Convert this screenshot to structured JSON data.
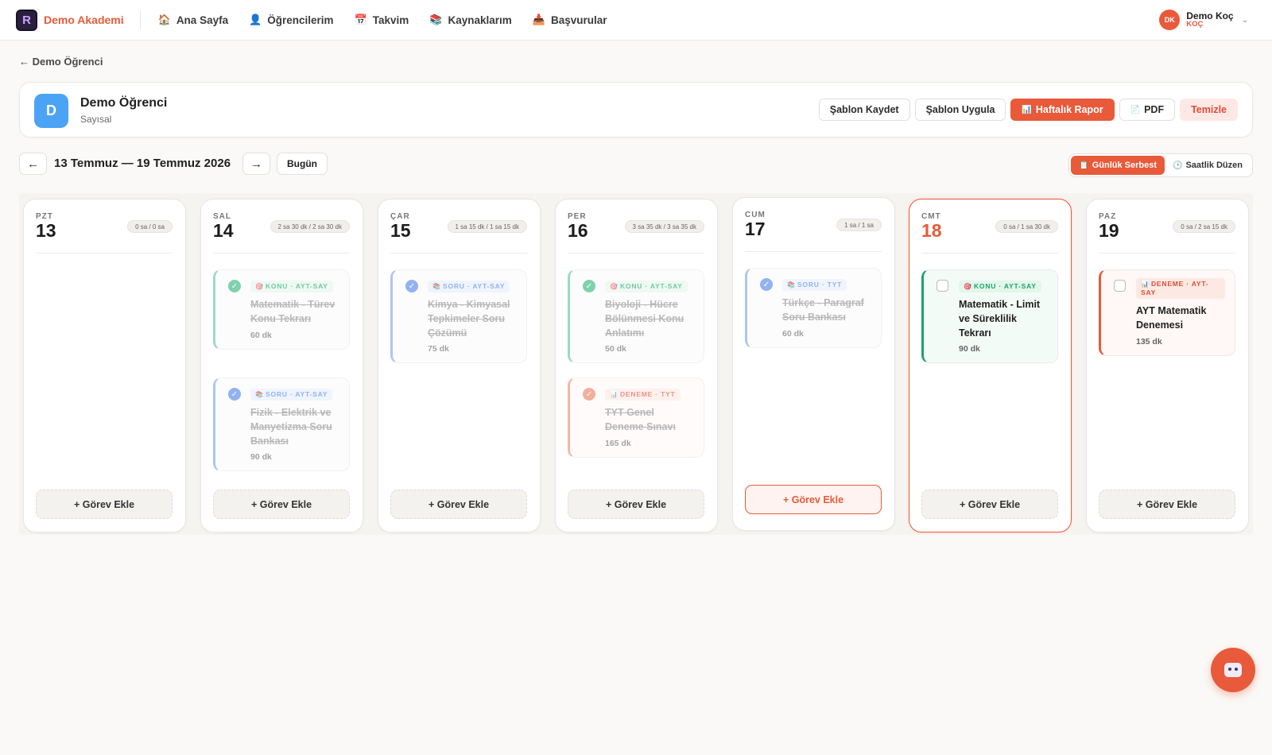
{
  "nav": {
    "brand": "Demo Akademi",
    "items": [
      {
        "label": "Ana Sayfa",
        "icon": "🏠"
      },
      {
        "label": "Öğrencilerim",
        "icon": "👤"
      },
      {
        "label": "Takvim",
        "icon": "📅"
      },
      {
        "label": "Kaynaklarım",
        "icon": "📚"
      },
      {
        "label": "Başvurular",
        "icon": "📥"
      }
    ],
    "user": {
      "initials": "DK",
      "name": "Demo Koç",
      "role": "KOÇ"
    }
  },
  "back_label": "← Demo Öğrenci",
  "student": {
    "initial": "D",
    "name": "Demo Öğrenci",
    "track": "Sayısal"
  },
  "header_buttons": {
    "save_template": "Şablon Kaydet",
    "apply_template": "Şablon Uygula",
    "weekly_report": "Haftalık Rapor",
    "pdf": "PDF",
    "clear": "Temizle"
  },
  "week": {
    "prev": "←",
    "next": "→",
    "title": "13 Temmuz — 19 Temmuz 2026",
    "today": "Bugün"
  },
  "modes": {
    "daily_free": "Günlük Serbest",
    "hourly": "Saatlik Düzen"
  },
  "add_task_label": "+ Görev Ekle",
  "colors": {
    "accent": "#e85a3a",
    "konu": "#1ba36a",
    "soru": "#4d7fe6",
    "deneme": "#e14b35"
  },
  "days": [
    {
      "name": "PZT",
      "num": "13",
      "time": "0 sa / 0 sa",
      "tasks": []
    },
    {
      "name": "SAL",
      "num": "14",
      "time": "2 sa 30 dk / 2 sa 30 dk",
      "tasks": [
        {
          "type": "konu",
          "icon": "🎯",
          "tag": "KONU · AYT-SAY",
          "title": "Matematik - Türev Konu Tekrarı",
          "duration": "60 dk",
          "done": true
        },
        {
          "type": "soru",
          "icon": "📚",
          "tag": "SORU · AYT-SAY",
          "title": "Fizik - Elektrik ve Manyetizma Soru Bankası",
          "duration": "90 dk",
          "done": true
        }
      ]
    },
    {
      "name": "ÇAR",
      "num": "15",
      "time": "1 sa 15 dk / 1 sa 15 dk",
      "tasks": [
        {
          "type": "soru",
          "icon": "📚",
          "tag": "SORU · AYT-SAY",
          "title": "Kimya - Kimyasal Tepkimeler Soru Çözümü",
          "duration": "75 dk",
          "done": true
        }
      ]
    },
    {
      "name": "PER",
      "num": "16",
      "time": "3 sa 35 dk / 3 sa 35 dk",
      "tasks": [
        {
          "type": "konu",
          "icon": "🎯",
          "tag": "KONU · AYT-SAY",
          "title": "Biyoloji - Hücre Bölünmesi Konu Anlatımı",
          "duration": "50 dk",
          "done": true
        },
        {
          "type": "deneme",
          "icon": "📊",
          "tag": "DENEME · TYT",
          "title": "TYT Genel Deneme Sınavı",
          "duration": "165 dk",
          "done": true
        }
      ]
    },
    {
      "name": "CUM",
      "num": "17",
      "time": "1 sa / 1 sa",
      "tasks": [
        {
          "type": "soru",
          "icon": "📚",
          "tag": "SORU · TYT",
          "title": "Türkçe - Paragraf Soru Bankası",
          "duration": "60 dk",
          "done": true
        }
      ]
    },
    {
      "name": "CMT",
      "num": "18",
      "time": "0 sa / 1 sa 30 dk",
      "tasks": [
        {
          "type": "konu",
          "icon": "🎯",
          "tag": "KONU · AYT-SAY",
          "title": "Matematik - Limit ve Süreklilik Tekrarı",
          "duration": "90 dk",
          "done": false
        }
      ]
    },
    {
      "name": "PAZ",
      "num": "19",
      "time": "0 sa / 2 sa 15 dk",
      "tasks": [
        {
          "type": "deneme",
          "icon": "📊",
          "tag": "DENEME · AYT-SAY",
          "title": "AYT Matematik Denemesi",
          "duration": "135 dk",
          "done": false
        }
      ]
    }
  ]
}
